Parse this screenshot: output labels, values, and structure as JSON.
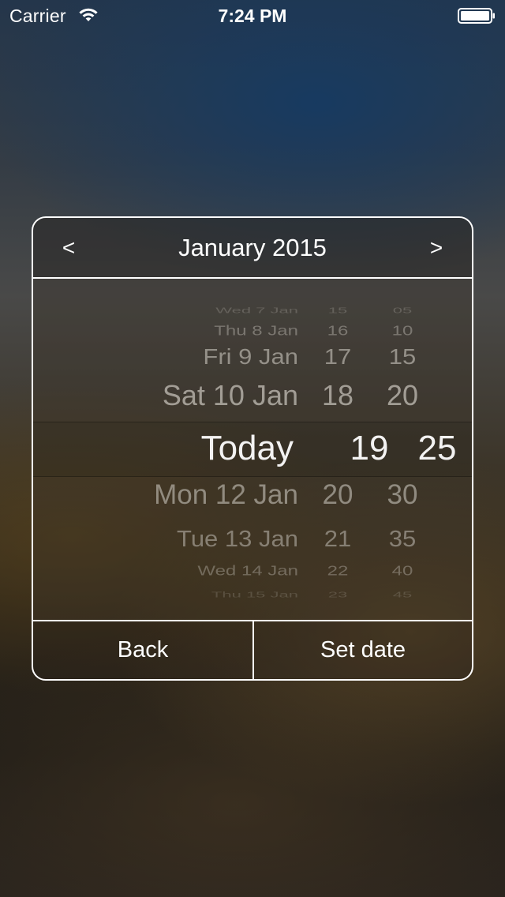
{
  "status_bar": {
    "carrier": "Carrier",
    "time": "7:24 PM",
    "wifi_icon": "wifi-icon",
    "battery_icon": "battery-icon",
    "battery_level": 1.0
  },
  "picker": {
    "title": "January 2015",
    "prev_label": "<",
    "next_label": ">",
    "rows": [
      {
        "date": "Wed 7 Jan",
        "hour": "15",
        "minute": "05"
      },
      {
        "date": "Thu 8 Jan",
        "hour": "16",
        "minute": "10"
      },
      {
        "date": "Fri 9 Jan",
        "hour": "17",
        "minute": "15"
      },
      {
        "date": "Sat 10 Jan",
        "hour": "18",
        "minute": "20"
      },
      {
        "date": "Today",
        "hour": "19",
        "minute": "25"
      },
      {
        "date": "Mon 12 Jan",
        "hour": "20",
        "minute": "30"
      },
      {
        "date": "Tue 13 Jan",
        "hour": "21",
        "minute": "35"
      },
      {
        "date": "Wed 14 Jan",
        "hour": "22",
        "minute": "40"
      },
      {
        "date": "Thu 15 Jan",
        "hour": "23",
        "minute": "45"
      }
    ],
    "selected_index": 4,
    "back_label": "Back",
    "set_label": "Set date"
  },
  "colors": {
    "accent": "#ffffff",
    "text_dim": "#c8c4bc"
  }
}
